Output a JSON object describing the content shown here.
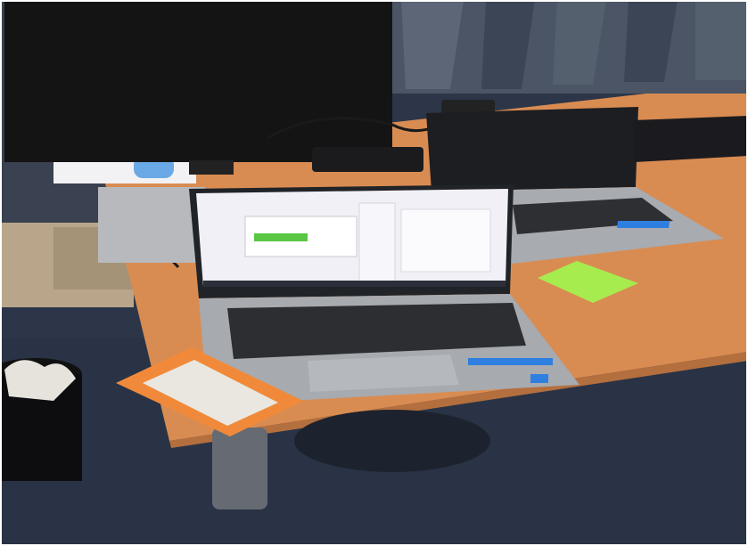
{
  "scene": {
    "objects": [
      "monitor",
      "laptop-front",
      "laptop-back",
      "external-hard-drive",
      "sticky-note",
      "laptop-bags",
      "waste-bin",
      "desk",
      "carpet"
    ]
  },
  "colors": {
    "carpet": "#2c3648",
    "desk": "#d98c52",
    "monitor": "#141414",
    "laptop_silver": "#9fa2a6",
    "screen_ui": "#f1f0f6",
    "ui_progress": "#59c744",
    "drive_orange": "#f08a3a",
    "sticky_note": "#a6ec4e",
    "bags": "#4b5566"
  }
}
